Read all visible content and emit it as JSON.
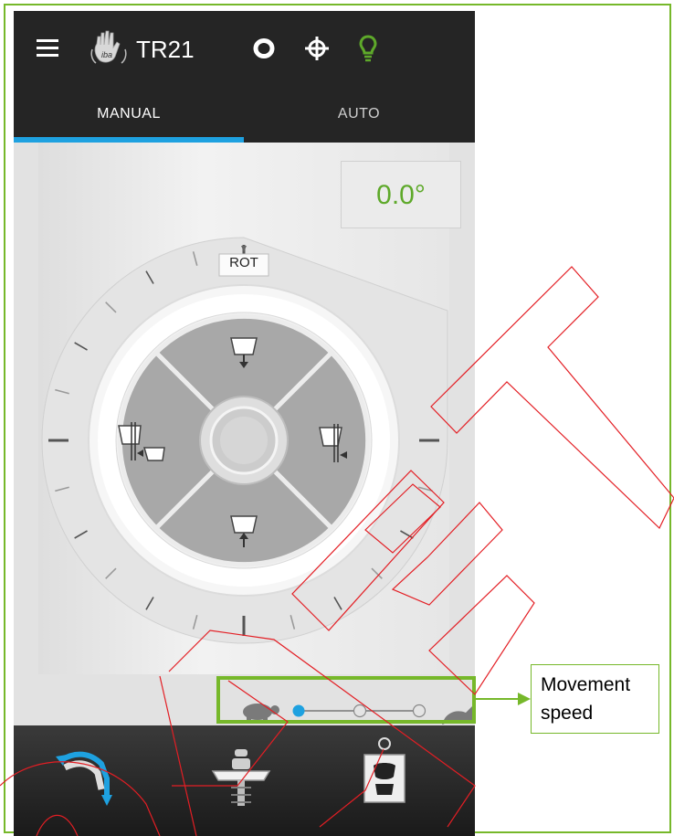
{
  "header": {
    "menu_icon": "hamburger-menu-icon",
    "logo_icon": "iba-hand-logo-icon",
    "title": "TR21",
    "status_icons": [
      "ring-status-icon",
      "crosshair-icon",
      "lightbulb-icon"
    ],
    "lightbulb_color": "#5ea92a"
  },
  "tabs": [
    {
      "label": "MANUAL",
      "active": true
    },
    {
      "label": "AUTO",
      "active": false
    }
  ],
  "tab_accent_color": "#1ea1e0",
  "angle_display": "0.0°",
  "dial": {
    "label": "ROT",
    "controls": [
      "move-down-icon",
      "move-left-icon",
      "move-right-icon",
      "move-up-icon"
    ],
    "center": "center-knob"
  },
  "speed": {
    "levels": 3,
    "selected": 1,
    "slow_icon": "turtle-icon",
    "fast_icon": "rabbit-icon"
  },
  "callout": {
    "text": "Movement speed"
  },
  "bottom_nav": [
    "gantry-rotation-icon",
    "patient-couch-icon",
    "patient-imaging-icon"
  ],
  "colors": {
    "annotation_green": "#76b82a",
    "accent_blue": "#1ea1e0",
    "angle_green": "#5ea92a",
    "red_marks": "#e31e24"
  }
}
